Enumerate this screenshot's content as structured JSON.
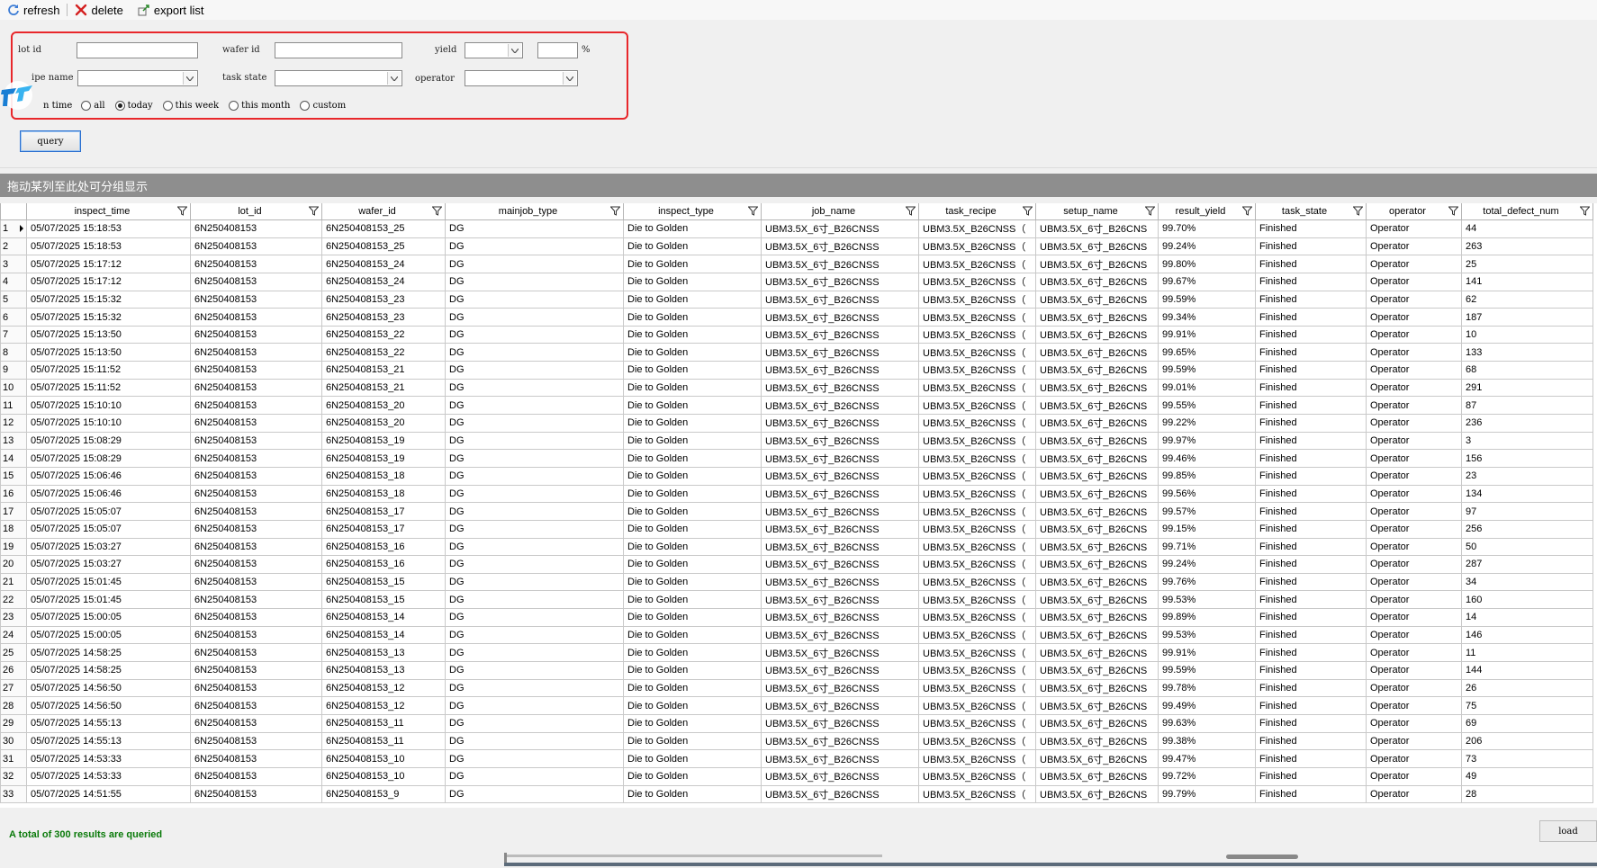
{
  "toolbar": {
    "refresh": "refresh",
    "delete": "delete",
    "export": "export list"
  },
  "filters": {
    "lot_id_label": "lot id",
    "lot_id_value": "",
    "wafer_id_label": "wafer id",
    "wafer_id_value": "",
    "yield_label": "yield",
    "yield_select": "",
    "yield_value": "",
    "yield_unit": "%",
    "recipe_name_label": "ipe name",
    "recipe_name_value": "",
    "task_state_label": "task state",
    "task_state_value": "",
    "operator_label": "operator",
    "operator_value": "",
    "time_label": "n time",
    "time_options": [
      "all",
      "today",
      "this week",
      "this month",
      "custom"
    ],
    "time_selected": "today",
    "query_label": "query"
  },
  "group_bar": "拖动某列至此处可分组显示",
  "table": {
    "columns": [
      "inspect_time",
      "lot_id",
      "wafer_id",
      "mainjob_type",
      "inspect_type",
      "job_name",
      "task_recipe",
      "setup_name",
      "result_yield",
      "task_state",
      "operator",
      "total_defect_num"
    ],
    "rows": [
      [
        "1",
        "05/07/2025 15:18:53",
        "6N250408153",
        "6N250408153_25",
        "DG",
        "Die to Golden",
        "UBM3.5X_6寸_B26CNSS",
        "UBM3.5X_B26CNSS（",
        "UBM3.5X_6寸_B26CNS",
        "99.70%",
        "Finished",
        "Operator",
        "44"
      ],
      [
        "2",
        "05/07/2025 15:18:53",
        "6N250408153",
        "6N250408153_25",
        "DG",
        "Die to Golden",
        "UBM3.5X_6寸_B26CNSS",
        "UBM3.5X_B26CNSS（",
        "UBM3.5X_6寸_B26CNS",
        "99.24%",
        "Finished",
        "Operator",
        "263"
      ],
      [
        "3",
        "05/07/2025 15:17:12",
        "6N250408153",
        "6N250408153_24",
        "DG",
        "Die to Golden",
        "UBM3.5X_6寸_B26CNSS",
        "UBM3.5X_B26CNSS（",
        "UBM3.5X_6寸_B26CNS",
        "99.80%",
        "Finished",
        "Operator",
        "25"
      ],
      [
        "4",
        "05/07/2025 15:17:12",
        "6N250408153",
        "6N250408153_24",
        "DG",
        "Die to Golden",
        "UBM3.5X_6寸_B26CNSS",
        "UBM3.5X_B26CNSS（",
        "UBM3.5X_6寸_B26CNS",
        "99.67%",
        "Finished",
        "Operator",
        "141"
      ],
      [
        "5",
        "05/07/2025 15:15:32",
        "6N250408153",
        "6N250408153_23",
        "DG",
        "Die to Golden",
        "UBM3.5X_6寸_B26CNSS",
        "UBM3.5X_B26CNSS（",
        "UBM3.5X_6寸_B26CNS",
        "99.59%",
        "Finished",
        "Operator",
        "62"
      ],
      [
        "6",
        "05/07/2025 15:15:32",
        "6N250408153",
        "6N250408153_23",
        "DG",
        "Die to Golden",
        "UBM3.5X_6寸_B26CNSS",
        "UBM3.5X_B26CNSS（",
        "UBM3.5X_6寸_B26CNS",
        "99.34%",
        "Finished",
        "Operator",
        "187"
      ],
      [
        "7",
        "05/07/2025 15:13:50",
        "6N250408153",
        "6N250408153_22",
        "DG",
        "Die to Golden",
        "UBM3.5X_6寸_B26CNSS",
        "UBM3.5X_B26CNSS（",
        "UBM3.5X_6寸_B26CNS",
        "99.91%",
        "Finished",
        "Operator",
        "10"
      ],
      [
        "8",
        "05/07/2025 15:13:50",
        "6N250408153",
        "6N250408153_22",
        "DG",
        "Die to Golden",
        "UBM3.5X_6寸_B26CNSS",
        "UBM3.5X_B26CNSS（",
        "UBM3.5X_6寸_B26CNS",
        "99.65%",
        "Finished",
        "Operator",
        "133"
      ],
      [
        "9",
        "05/07/2025 15:11:52",
        "6N250408153",
        "6N250408153_21",
        "DG",
        "Die to Golden",
        "UBM3.5X_6寸_B26CNSS",
        "UBM3.5X_B26CNSS（",
        "UBM3.5X_6寸_B26CNS",
        "99.59%",
        "Finished",
        "Operator",
        "68"
      ],
      [
        "10",
        "05/07/2025 15:11:52",
        "6N250408153",
        "6N250408153_21",
        "DG",
        "Die to Golden",
        "UBM3.5X_6寸_B26CNSS",
        "UBM3.5X_B26CNSS（",
        "UBM3.5X_6寸_B26CNS",
        "99.01%",
        "Finished",
        "Operator",
        "291"
      ],
      [
        "11",
        "05/07/2025 15:10:10",
        "6N250408153",
        "6N250408153_20",
        "DG",
        "Die to Golden",
        "UBM3.5X_6寸_B26CNSS",
        "UBM3.5X_B26CNSS（",
        "UBM3.5X_6寸_B26CNS",
        "99.55%",
        "Finished",
        "Operator",
        "87"
      ],
      [
        "12",
        "05/07/2025 15:10:10",
        "6N250408153",
        "6N250408153_20",
        "DG",
        "Die to Golden",
        "UBM3.5X_6寸_B26CNSS",
        "UBM3.5X_B26CNSS（",
        "UBM3.5X_6寸_B26CNS",
        "99.22%",
        "Finished",
        "Operator",
        "236"
      ],
      [
        "13",
        "05/07/2025 15:08:29",
        "6N250408153",
        "6N250408153_19",
        "DG",
        "Die to Golden",
        "UBM3.5X_6寸_B26CNSS",
        "UBM3.5X_B26CNSS（",
        "UBM3.5X_6寸_B26CNS",
        "99.97%",
        "Finished",
        "Operator",
        "3"
      ],
      [
        "14",
        "05/07/2025 15:08:29",
        "6N250408153",
        "6N250408153_19",
        "DG",
        "Die to Golden",
        "UBM3.5X_6寸_B26CNSS",
        "UBM3.5X_B26CNSS（",
        "UBM3.5X_6寸_B26CNS",
        "99.46%",
        "Finished",
        "Operator",
        "156"
      ],
      [
        "15",
        "05/07/2025 15:06:46",
        "6N250408153",
        "6N250408153_18",
        "DG",
        "Die to Golden",
        "UBM3.5X_6寸_B26CNSS",
        "UBM3.5X_B26CNSS（",
        "UBM3.5X_6寸_B26CNS",
        "99.85%",
        "Finished",
        "Operator",
        "23"
      ],
      [
        "16",
        "05/07/2025 15:06:46",
        "6N250408153",
        "6N250408153_18",
        "DG",
        "Die to Golden",
        "UBM3.5X_6寸_B26CNSS",
        "UBM3.5X_B26CNSS（",
        "UBM3.5X_6寸_B26CNS",
        "99.56%",
        "Finished",
        "Operator",
        "134"
      ],
      [
        "17",
        "05/07/2025 15:05:07",
        "6N250408153",
        "6N250408153_17",
        "DG",
        "Die to Golden",
        "UBM3.5X_6寸_B26CNSS",
        "UBM3.5X_B26CNSS（",
        "UBM3.5X_6寸_B26CNS",
        "99.57%",
        "Finished",
        "Operator",
        "97"
      ],
      [
        "18",
        "05/07/2025 15:05:07",
        "6N250408153",
        "6N250408153_17",
        "DG",
        "Die to Golden",
        "UBM3.5X_6寸_B26CNSS",
        "UBM3.5X_B26CNSS（",
        "UBM3.5X_6寸_B26CNS",
        "99.15%",
        "Finished",
        "Operator",
        "256"
      ],
      [
        "19",
        "05/07/2025 15:03:27",
        "6N250408153",
        "6N250408153_16",
        "DG",
        "Die to Golden",
        "UBM3.5X_6寸_B26CNSS",
        "UBM3.5X_B26CNSS（",
        "UBM3.5X_6寸_B26CNS",
        "99.71%",
        "Finished",
        "Operator",
        "50"
      ],
      [
        "20",
        "05/07/2025 15:03:27",
        "6N250408153",
        "6N250408153_16",
        "DG",
        "Die to Golden",
        "UBM3.5X_6寸_B26CNSS",
        "UBM3.5X_B26CNSS（",
        "UBM3.5X_6寸_B26CNS",
        "99.24%",
        "Finished",
        "Operator",
        "287"
      ],
      [
        "21",
        "05/07/2025 15:01:45",
        "6N250408153",
        "6N250408153_15",
        "DG",
        "Die to Golden",
        "UBM3.5X_6寸_B26CNSS",
        "UBM3.5X_B26CNSS（",
        "UBM3.5X_6寸_B26CNS",
        "99.76%",
        "Finished",
        "Operator",
        "34"
      ],
      [
        "22",
        "05/07/2025 15:01:45",
        "6N250408153",
        "6N250408153_15",
        "DG",
        "Die to Golden",
        "UBM3.5X_6寸_B26CNSS",
        "UBM3.5X_B26CNSS（",
        "UBM3.5X_6寸_B26CNS",
        "99.53%",
        "Finished",
        "Operator",
        "160"
      ],
      [
        "23",
        "05/07/2025 15:00:05",
        "6N250408153",
        "6N250408153_14",
        "DG",
        "Die to Golden",
        "UBM3.5X_6寸_B26CNSS",
        "UBM3.5X_B26CNSS（",
        "UBM3.5X_6寸_B26CNS",
        "99.89%",
        "Finished",
        "Operator",
        "14"
      ],
      [
        "24",
        "05/07/2025 15:00:05",
        "6N250408153",
        "6N250408153_14",
        "DG",
        "Die to Golden",
        "UBM3.5X_6寸_B26CNSS",
        "UBM3.5X_B26CNSS（",
        "UBM3.5X_6寸_B26CNS",
        "99.53%",
        "Finished",
        "Operator",
        "146"
      ],
      [
        "25",
        "05/07/2025 14:58:25",
        "6N250408153",
        "6N250408153_13",
        "DG",
        "Die to Golden",
        "UBM3.5X_6寸_B26CNSS",
        "UBM3.5X_B26CNSS（",
        "UBM3.5X_6寸_B26CNS",
        "99.91%",
        "Finished",
        "Operator",
        "11"
      ],
      [
        "26",
        "05/07/2025 14:58:25",
        "6N250408153",
        "6N250408153_13",
        "DG",
        "Die to Golden",
        "UBM3.5X_6寸_B26CNSS",
        "UBM3.5X_B26CNSS（",
        "UBM3.5X_6寸_B26CNS",
        "99.59%",
        "Finished",
        "Operator",
        "144"
      ],
      [
        "27",
        "05/07/2025 14:56:50",
        "6N250408153",
        "6N250408153_12",
        "DG",
        "Die to Golden",
        "UBM3.5X_6寸_B26CNSS",
        "UBM3.5X_B26CNSS（",
        "UBM3.5X_6寸_B26CNS",
        "99.78%",
        "Finished",
        "Operator",
        "26"
      ],
      [
        "28",
        "05/07/2025 14:56:50",
        "6N250408153",
        "6N250408153_12",
        "DG",
        "Die to Golden",
        "UBM3.5X_6寸_B26CNSS",
        "UBM3.5X_B26CNSS（",
        "UBM3.5X_6寸_B26CNS",
        "99.49%",
        "Finished",
        "Operator",
        "75"
      ],
      [
        "29",
        "05/07/2025 14:55:13",
        "6N250408153",
        "6N250408153_11",
        "DG",
        "Die to Golden",
        "UBM3.5X_6寸_B26CNSS",
        "UBM3.5X_B26CNSS（",
        "UBM3.5X_6寸_B26CNS",
        "99.63%",
        "Finished",
        "Operator",
        "69"
      ],
      [
        "30",
        "05/07/2025 14:55:13",
        "6N250408153",
        "6N250408153_11",
        "DG",
        "Die to Golden",
        "UBM3.5X_6寸_B26CNSS",
        "UBM3.5X_B26CNSS（",
        "UBM3.5X_6寸_B26CNS",
        "99.38%",
        "Finished",
        "Operator",
        "206"
      ],
      [
        "31",
        "05/07/2025 14:53:33",
        "6N250408153",
        "6N250408153_10",
        "DG",
        "Die to Golden",
        "UBM3.5X_6寸_B26CNSS",
        "UBM3.5X_B26CNSS（",
        "UBM3.5X_6寸_B26CNS",
        "99.47%",
        "Finished",
        "Operator",
        "73"
      ],
      [
        "32",
        "05/07/2025 14:53:33",
        "6N250408153",
        "6N250408153_10",
        "DG",
        "Die to Golden",
        "UBM3.5X_6寸_B26CNSS",
        "UBM3.5X_B26CNSS（",
        "UBM3.5X_6寸_B26CNS",
        "99.72%",
        "Finished",
        "Operator",
        "49"
      ],
      [
        "33",
        "05/07/2025 14:51:55",
        "6N250408153",
        "6N250408153_9",
        "DG",
        "Die to Golden",
        "UBM3.5X_6寸_B26CNSS",
        "UBM3.5X_B26CNSS（",
        "UBM3.5X_6寸_B26CNS",
        "99.79%",
        "Finished",
        "Operator",
        "28"
      ]
    ]
  },
  "status": {
    "summary": "A total of 300 results are queried",
    "load_label": "load"
  },
  "colors": {
    "highlight_border": "#e8272b",
    "status_text": "#0a7a0a",
    "group_bar": "#8e8e8e"
  },
  "icons": {
    "refresh": "refresh-icon",
    "delete": "delete-x-icon",
    "export": "export-icon",
    "filter": "funnel-icon"
  }
}
